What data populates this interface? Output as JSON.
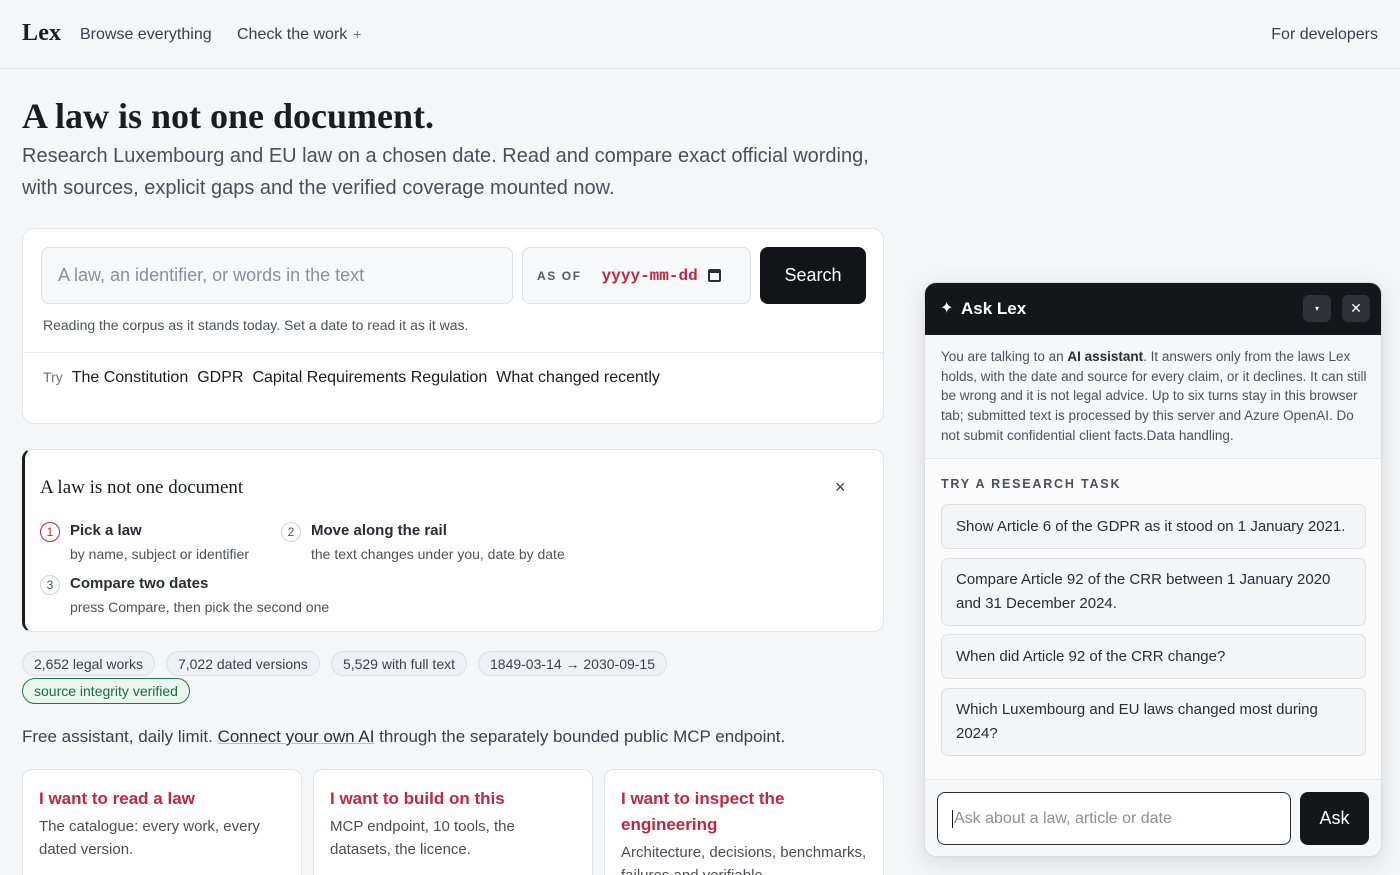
{
  "nav": {
    "brand": "Lex",
    "browse": "Browse everything",
    "check": "Check the work",
    "check_plus": "+",
    "developers": "For developers"
  },
  "hero": {
    "title": "A law is not one document.",
    "subtitle": "Research Luxembourg and EU law on a chosen date. Read and compare exact official wording, with sources, explicit gaps and the verified coverage mounted now."
  },
  "search": {
    "placeholder": "A law, an identifier, or words in the text",
    "asof_label": "AS OF",
    "date_placeholder": "yyyy-mm-dd",
    "button": "Search",
    "note": "Reading the corpus as it stands today. Set a date to read it as it was.",
    "try_label": "Try",
    "suggestions": [
      "The Constitution",
      "GDPR",
      "Capital Requirements Regulation",
      "What changed recently"
    ]
  },
  "info": {
    "title": "A law is not one document",
    "close": "×",
    "steps": [
      {
        "num": "1",
        "title": "Pick a law",
        "sub": "by name, subject or identifier"
      },
      {
        "num": "2",
        "title": "Move along the rail",
        "sub": "the text changes under you, date by date"
      },
      {
        "num": "3",
        "title": "Compare two dates",
        "sub": "press Compare, then pick the second one"
      }
    ]
  },
  "stats": {
    "works": "2,652 legal works",
    "versions": "7,022 dated versions",
    "fulltext": "5,529 with full text",
    "range": "1849-03-14 → 2030-09-15",
    "verified": "source integrity verified"
  },
  "free": {
    "before": "Free assistant, daily limit. ",
    "link": "Connect your own AI",
    "after": " through the separately bounded public MCP endpoint."
  },
  "cards": [
    {
      "title": "I want to read a law",
      "desc": "The catalogue: every work, every dated version."
    },
    {
      "title": "I want to build on this",
      "desc": "MCP endpoint, 10 tools, the datasets, the licence."
    },
    {
      "title": "I want to inspect the engineering",
      "desc": "Architecture, decisions, benchmarks, failures and verifiable"
    }
  ],
  "chat": {
    "star": "✦",
    "title": "Ask Lex",
    "minimize": "▾",
    "close": "✕",
    "disclaimer_pre": "You are talking to an ",
    "disclaimer_bold": "AI assistant",
    "disclaimer_post": ". It answers only from the laws Lex holds, with the date and source for every claim, or it declines. It can still be wrong and it is not legal advice. Up to six turns stay in this browser tab; submitted text is processed by this server and Azure OpenAI. Do not submit confidential client facts.Data handling.",
    "task_heading": "TRY A RESEARCH TASK",
    "tasks": [
      "Show Article 6 of the GDPR as it stood on 1 January 2021.",
      "Compare Article 92 of the CRR between 1 January 2020 and 31 December 2024.",
      "When did Article 92 of the CRR change?",
      "Which Luxembourg and EU laws changed most during 2024?"
    ],
    "input_placeholder": "Ask about a law, article or date",
    "ask_button": "Ask"
  }
}
